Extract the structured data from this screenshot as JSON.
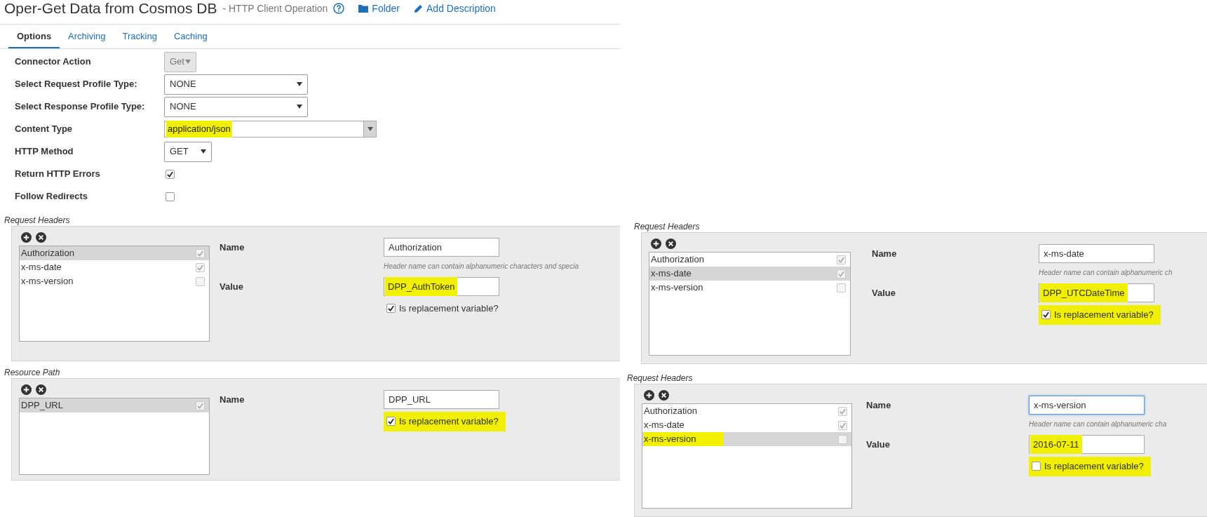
{
  "header": {
    "title": "Oper-Get Data from Cosmos DB",
    "subtitle": "- HTTP Client Operation",
    "links": [
      {
        "kind": "folder",
        "label": "Folder"
      },
      {
        "kind": "edit",
        "label": "Add Description"
      }
    ]
  },
  "tabs": [
    {
      "label": "Options",
      "selected": true
    },
    {
      "label": "Archiving",
      "selected": false
    },
    {
      "label": "Tracking",
      "selected": false
    },
    {
      "label": "Caching",
      "selected": false
    }
  ],
  "form": [
    {
      "kind": "select",
      "label": "Connector Action",
      "value": "Get",
      "disabled": true,
      "highlighted": false
    },
    {
      "kind": "select",
      "label": "Select Request Profile Type:",
      "value": "NONE",
      "disabled": false,
      "highlighted": false
    },
    {
      "kind": "select",
      "label": "Select Response Profile Type:",
      "value": "NONE",
      "disabled": false,
      "highlighted": false
    },
    {
      "kind": "combo",
      "label": "Content Type",
      "value": "application/json",
      "disabled": false,
      "highlighted": true
    },
    {
      "kind": "select",
      "label": "HTTP Method",
      "value": "GET",
      "disabled": false,
      "highlighted": false
    },
    {
      "kind": "checkbox",
      "label": "Return HTTP Errors",
      "checked": true
    },
    {
      "kind": "checkbox",
      "label": "Follow Redirects",
      "checked": false
    }
  ],
  "left_panels": [
    {
      "title": "Request Headers",
      "items": [
        {
          "name": "Authorization",
          "checked": true,
          "selected": true,
          "highlighted": false
        },
        {
          "name": "x-ms-date",
          "checked": true,
          "selected": false,
          "highlighted": false
        },
        {
          "name": "x-ms-version",
          "checked": false,
          "selected": false,
          "highlighted": false
        }
      ],
      "name_label": "Name",
      "name_value": "Authorization",
      "name_focused": false,
      "hint": "Header name can contain alphanumeric characters and specia",
      "value_label": "Value",
      "value": "DPP_AuthToken",
      "value_highlighted": true,
      "replacement_label": "Is replacement variable?",
      "replacement": true,
      "replacement_highlighted": false
    },
    {
      "title": "Resource Path",
      "items": [
        {
          "name": "DPP_URL",
          "checked": true,
          "selected": true,
          "highlighted": false
        }
      ],
      "name_label": "Name",
      "name_value": "DPP_URL",
      "name_focused": false,
      "replacement_label": "Is replacement variable?",
      "replacement": true,
      "replacement_highlighted": true
    }
  ],
  "right_panels": [
    {
      "title": "Request Headers",
      "items": [
        {
          "name": "Authorization",
          "checked": true,
          "selected": false,
          "highlighted": false
        },
        {
          "name": "x-ms-date",
          "checked": true,
          "selected": true,
          "highlighted": false
        },
        {
          "name": "x-ms-version",
          "checked": false,
          "selected": false,
          "highlighted": false
        }
      ],
      "name_label": "Name",
      "name_value": "x-ms-date",
      "name_focused": false,
      "hint": "Header name can contain alphanumeric ch",
      "value_label": "Value",
      "value": "DPP_UTCDateTime",
      "value_highlighted": true,
      "replacement_label": "Is replacement variable?",
      "replacement": true,
      "replacement_highlighted": true
    },
    {
      "title": "Request Headers",
      "items": [
        {
          "name": "Authorization",
          "checked": true,
          "selected": false,
          "highlighted": false
        },
        {
          "name": "x-ms-date",
          "checked": true,
          "selected": false,
          "highlighted": false
        },
        {
          "name": "x-ms-version",
          "checked": false,
          "selected": true,
          "highlighted": true
        }
      ],
      "name_label": "Name",
      "name_value": "x-ms-version",
      "name_focused": true,
      "hint": "Header name can contain alphanumeric cha",
      "value_label": "Value",
      "value": "2016-07-11",
      "value_highlighted": true,
      "replacement_label": "Is replacement variable?",
      "replacement": false,
      "replacement_highlighted": true
    }
  ]
}
